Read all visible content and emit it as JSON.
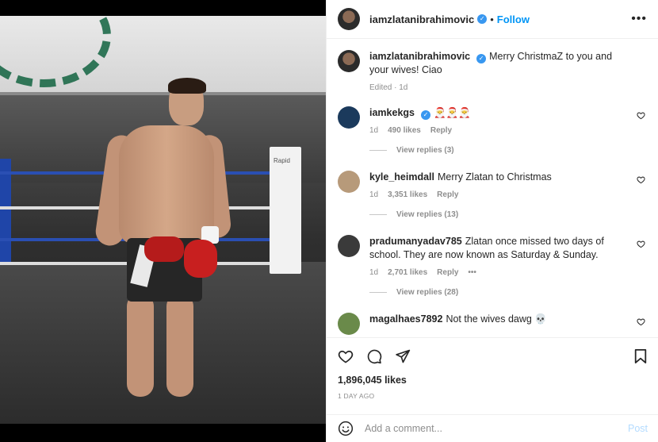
{
  "post": {
    "author": "iamzlatanibrahimovic",
    "follow_label": "Follow",
    "more_label": "•••",
    "caption_text": "Merry ChristmaZ to you and your wives! Ciao",
    "caption_meta": "Edited · 1d",
    "likes": "1,896,045 likes",
    "date": "1 DAY AGO"
  },
  "comments": [
    {
      "user": "iamkekgs",
      "text": "🎅🎅🎅",
      "time": "1d",
      "likes": "490 likes",
      "reply": "Reply",
      "replies": "View replies (3)",
      "avatar_color": "#1b3a5c"
    },
    {
      "user": "kyle_heimdall",
      "text": "Merry Zlatan to Christmas",
      "time": "1d",
      "likes": "3,351 likes",
      "reply": "Reply",
      "replies": "View replies (13)",
      "avatar_color": "#b79a7a"
    },
    {
      "user": "pradumanyadav785",
      "text": "Zlatan once missed two days of school. They are now known as Saturday & Sunday.",
      "time": "1d",
      "likes": "2,701 likes",
      "reply": "Reply",
      "more": "•••",
      "replies": "View replies (28)",
      "avatar_color": "#3a3a3a"
    },
    {
      "user": "magalhaes7892",
      "text": "Not the wives dawg 💀",
      "avatar_color": "#6a8a4a"
    }
  ],
  "composer": {
    "placeholder": "Add a comment...",
    "post_label": "Post"
  },
  "photo_text": {
    "post_label": "Rapid"
  },
  "icons": {
    "like": "heart-icon",
    "comment": "comment-icon",
    "share": "share-icon",
    "save": "bookmark-icon",
    "emoji": "emoji-icon",
    "verified": "verified-badge-icon"
  },
  "colors": {
    "link": "#0095f6",
    "verified": "#3897f0",
    "muted": "#8e8e8e",
    "post_disabled": "#b3dbff"
  }
}
